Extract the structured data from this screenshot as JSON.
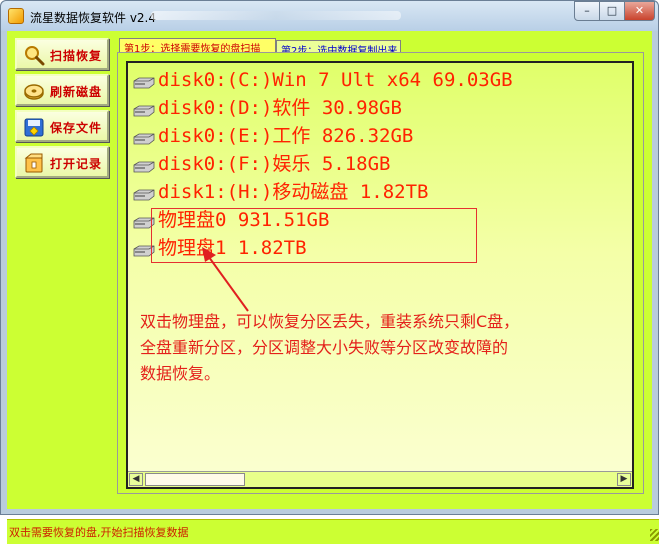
{
  "window": {
    "title": "流星数据恢复软件 v2.4",
    "controls": {
      "minimize": "–",
      "maximize": "□",
      "close": "✕"
    }
  },
  "sidebar": {
    "buttons": [
      {
        "label": "扫描恢复",
        "icon": "magnifier-icon"
      },
      {
        "label": "刷新磁盘",
        "icon": "refresh-disk-icon"
      },
      {
        "label": "保存文件",
        "icon": "save-file-icon"
      },
      {
        "label": "打开记录",
        "icon": "open-record-icon"
      }
    ]
  },
  "tabs": [
    {
      "label": "第1步：选择需要恢复的盘扫描",
      "active": true
    },
    {
      "label": "第2步：选中数据复制出来",
      "active": false
    }
  ],
  "disk_list": [
    {
      "label": "disk0:(C:)Win 7 Ult x64 69.03GB",
      "icon": "drive-icon"
    },
    {
      "label": "disk0:(D:)软件 30.98GB",
      "icon": "drive-icon"
    },
    {
      "label": "disk0:(E:)工作 826.32GB",
      "icon": "drive-icon"
    },
    {
      "label": "disk0:(F:)娱乐 5.18GB",
      "icon": "drive-icon"
    },
    {
      "label": "disk1:(H:)移动磁盘 1.82TB",
      "icon": "drive-icon"
    },
    {
      "label": "物理盘0 931.51GB",
      "icon": "drive-icon"
    },
    {
      "label": "物理盘1 1.82TB",
      "icon": "drive-icon"
    }
  ],
  "annotation": {
    "lines": [
      "双击物理盘，可以恢复分区丢失，重装系统只剩C盘，",
      "全盘重新分区，分区调整大小失败等分区改变故障的",
      "数据恢复。"
    ]
  },
  "status": {
    "text": "双击需要恢复的盘,开始扫描恢复数据"
  },
  "colors": {
    "client_bg": "#ccff33",
    "item_text": "#ff2200",
    "annotation": "#e4201a"
  }
}
